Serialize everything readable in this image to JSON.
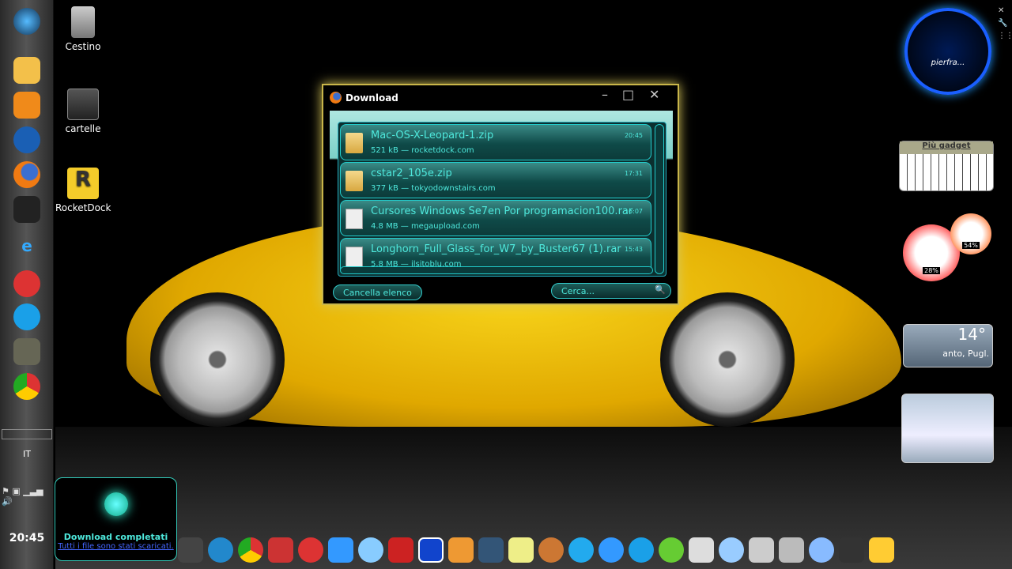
{
  "desktop": {
    "icons": [
      {
        "label": "Cestino",
        "icon": "recycle-bin-icon"
      },
      {
        "label": "cartelle",
        "icon": "folder-icon"
      },
      {
        "label": "RocketDock",
        "icon": "rocketdock-icon"
      }
    ]
  },
  "taskbar": {
    "language": "IT",
    "clock": "20:45",
    "pins": [
      "start-orb-icon",
      "explorer-icon",
      "media-player-icon",
      "hp-icon",
      "firefox-icon",
      "gadget-icon",
      "ie-icon",
      "download-icon",
      "skype-icon",
      "gimp-icon",
      "chrome-icon"
    ]
  },
  "download_window": {
    "title": "Download",
    "items": [
      {
        "name": "Mac-OS-X-Leopard-1.zip",
        "size": "521 kB",
        "source": "rocketdock.com",
        "time": "20:45",
        "type": "zip"
      },
      {
        "name": "cstar2_105e.zip",
        "size": "377 kB",
        "source": "tokyodownstairs.com",
        "time": "17:31",
        "type": "zip"
      },
      {
        "name": "Cursores Windows Se7en Por programacion100.rar",
        "size": "4.8 MB",
        "source": "megaupload.com",
        "time": "16:07",
        "type": "rar"
      },
      {
        "name": "Longhorn_Full_Glass_for_W7_by_Buster67 (1).rar",
        "size": "5.8 MB",
        "source": "ilsitoblu.com",
        "time": "15:43",
        "type": "rar"
      }
    ],
    "clear_label": "Cancella elenco",
    "search_placeholder": "Cerca..."
  },
  "gadgets": {
    "more_label": "Più gadget",
    "cpu_percent": "28%",
    "memory_percent": "54%",
    "temperature": "14°",
    "location": "anto, Pugl.",
    "clock_label": "pierfra..."
  },
  "notification": {
    "title": "Download completati",
    "link": "Tutti i file sono stati scaricati."
  },
  "colors": {
    "accent": "#4ee8dc",
    "window_glow": "#d8c85a"
  }
}
